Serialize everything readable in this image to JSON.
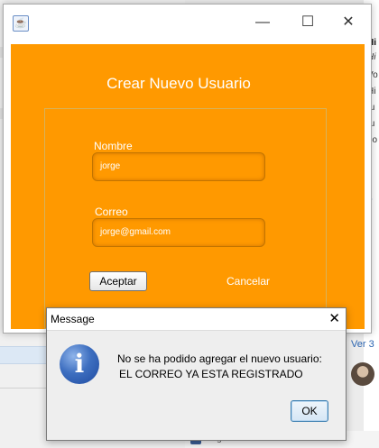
{
  "background": {
    "right_fragments": [
      "Hi",
      "Hi",
      "Vo",
      "Hi",
      "fu",
      "fu",
      "bo",
      "?",
      "r"
    ],
    "link_text": "Ver 3",
    "bottom_text": "ueges"
  },
  "window": {
    "form_title": "Crear Nuevo Usuario",
    "name_label": "Nombre",
    "name_value": "jorge",
    "email_label": "Correo",
    "email_value": "jorge@gmail.com",
    "accept_label": "Aceptar",
    "cancel_label": "Cancelar",
    "minimize": "—",
    "maximize": "☐",
    "close": "✕",
    "accent_color": "#ff9900"
  },
  "dialog": {
    "title": "Message",
    "close": "✕",
    "icon": "info-icon",
    "icon_glyph": "i",
    "line1": "No se ha podido agregar el nuevo usuario:",
    "line2": "EL CORREO YA ESTA REGISTRADO",
    "ok_label": "OK"
  }
}
